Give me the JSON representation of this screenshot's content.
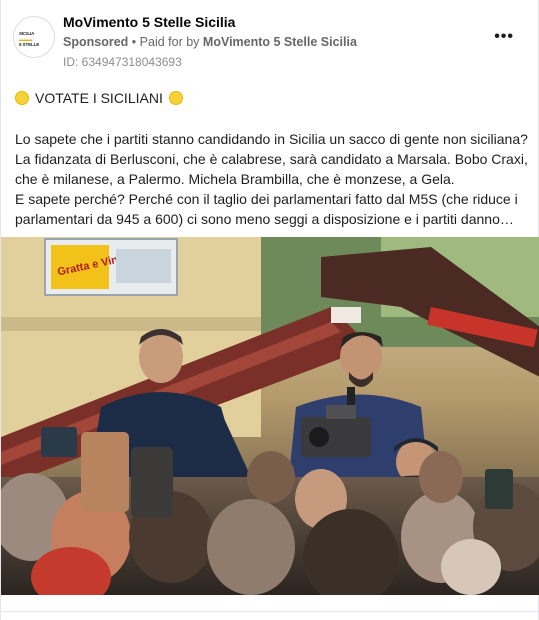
{
  "post": {
    "page_name": "MoVimento 5 Stelle Sicilia",
    "sponsored": "Sponsored",
    "separator": "•",
    "paid_for": "Paid for by",
    "payer": "MoVimento 5 Stelle Sicilia",
    "ad_id": "ID: 634947318043693",
    "more_icon": "more-horizontal-icon",
    "avatar_line1": "SICILIA",
    "avatar_line2": "5 STELLE",
    "headline": "VOTATE I SICILIANI",
    "body_lines": [
      "Lo sapete che i partiti stanno candidando in Sicilia un sacco di gente non siciliana?",
      "La fidanzata di Berlusconi, che è calabrese, sarà candidato a Marsala. Bobo Craxi, che è milanese, a Palermo. Michela Brambilla, che è monzese, a Gela.",
      "E sapete perché? Perché con il taglio dei parlamentari fatto dal M5S (che riduce i parlamentari da 945 a 600) ci sono meno seggi a disposizione e i partiti danno…"
    ],
    "photo_sign": "Gratta e Vinci"
  },
  "colors": {
    "emoji_yellow": "#f7d13a",
    "meta_gray": "#65676b",
    "text": "#1c1e21"
  }
}
